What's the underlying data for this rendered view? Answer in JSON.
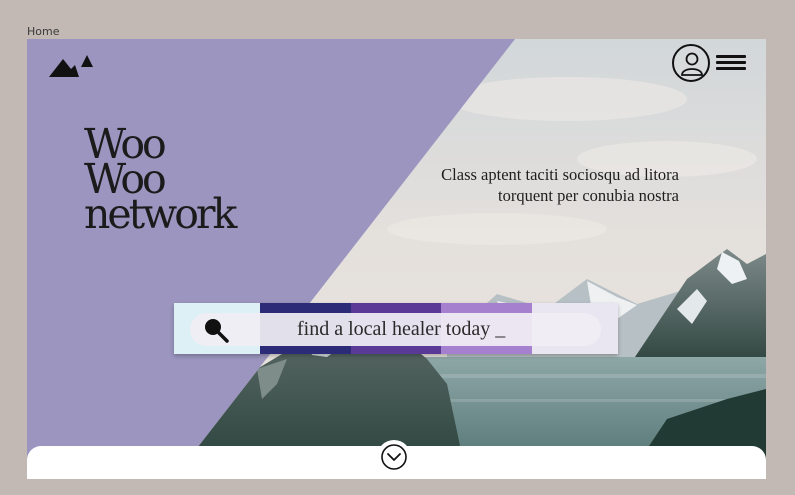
{
  "breadcrumb": {
    "home_label": "Home"
  },
  "header": {
    "logo_icon": "mountain-logo-icon",
    "account_icon": "user-account-icon",
    "menu_icon": "hamburger-menu-icon"
  },
  "hero": {
    "brand_lines": [
      "Woo",
      "Woo",
      "network"
    ],
    "tagline": "Class aptent taciti sociosqu ad litora torquent per conubia nostra",
    "overlay_color": "#9b95bf",
    "search": {
      "icon": "search-icon",
      "text": "find a local healer today _",
      "stripe_colors": [
        "#ddf0f6",
        "#2c2b78",
        "#5a3a96",
        "#a580cf",
        "#e9e6f2"
      ]
    }
  },
  "footer": {
    "scroll_icon": "chevron-down-icon"
  }
}
